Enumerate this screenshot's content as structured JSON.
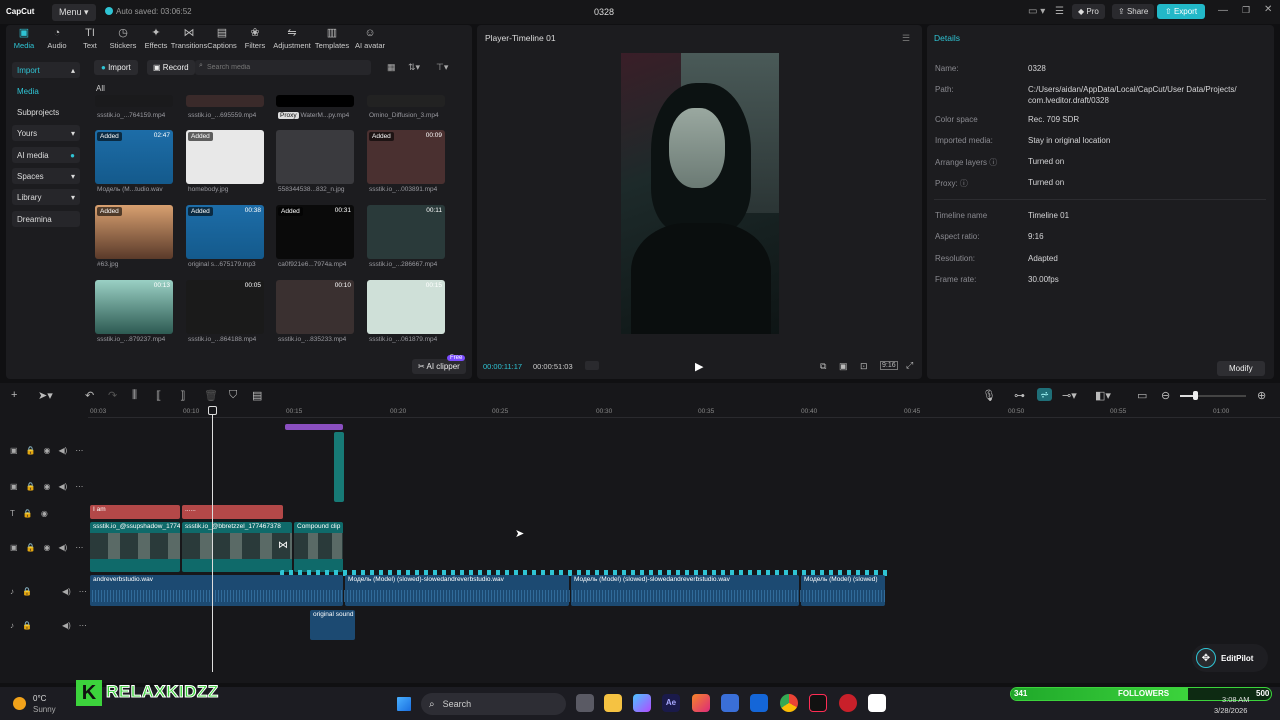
{
  "titlebar": {
    "logo": "CapCut",
    "menu_label": "Menu",
    "autosave": "Auto saved: 03:06:52",
    "project_title": "0328",
    "pro_label": "Pro",
    "share_label": "Share",
    "export_label": "Export"
  },
  "toolbar": {
    "items": [
      "Media",
      "Audio",
      "Text",
      "Stickers",
      "Effects",
      "Transitions",
      "Captions",
      "Filters",
      "Adjustment",
      "Templates",
      "AI avatar"
    ]
  },
  "sidebar": {
    "import": "Import",
    "media": "Media",
    "subprojects": "Subprojects",
    "yours": "Yours",
    "ai_media": "AI media",
    "spaces": "Spaces",
    "library": "Library",
    "dreamina": "Dreamina"
  },
  "media_panel": {
    "import_btn": "Import",
    "record_btn": "Record",
    "search_placeholder": "Search media",
    "all_label": "All",
    "ai_clipper": "AI clipper",
    "free_badge": "Free",
    "row0": [
      "ssstik.io_...764159.mp4",
      "ssstik.io_...695559.mp4",
      "WaterM...py.mp4",
      "Omino_Diffusion_3.mp4"
    ],
    "proxy_badge": "Proxy",
    "items": [
      {
        "name": "Модель (M...tudio.wav",
        "badge": "Added",
        "dur": "02:47"
      },
      {
        "name": "homebody.jpg",
        "badge": "Added",
        "dur": ""
      },
      {
        "name": "558344538...832_n.jpg",
        "badge": "",
        "dur": ""
      },
      {
        "name": "ssstik.io_...003891.mp4",
        "badge": "Added",
        "dur": "00:09"
      },
      {
        "name": "#63.jpg",
        "badge": "Added",
        "dur": ""
      },
      {
        "name": "original s...675179.mp3",
        "badge": "Added",
        "dur": "00:38"
      },
      {
        "name": "ca0f921e6...7974a.mp4",
        "badge": "Added",
        "dur": "00:31"
      },
      {
        "name": "ssstik.io_...286667.mp4",
        "badge": "",
        "dur": "00:11"
      },
      {
        "name": "ssstik.io_...879237.mp4",
        "badge": "",
        "dur": "00:13"
      },
      {
        "name": "ssstik.io_...864188.mp4",
        "badge": "",
        "dur": "00:05"
      },
      {
        "name": "ssstik.io_...835233.mp4",
        "badge": "",
        "dur": "00:10"
      },
      {
        "name": "ssstik.io_...061879.mp4",
        "badge": "",
        "dur": "00:15"
      }
    ]
  },
  "player": {
    "title": "Player-Timeline 01",
    "current_time": "00:00:11:17",
    "total_time": "00:00:51:03",
    "ratio": "9:16"
  },
  "details": {
    "title": "Details",
    "rows": [
      {
        "k": "Name:",
        "v": "0328"
      },
      {
        "k": "Path:",
        "v": "C:/Users/aidan/AppData/Local/CapCut/User Data/Projects/ com.lveditor.draft/0328"
      },
      {
        "k": "Color space",
        "v": "Rec. 709 SDR"
      },
      {
        "k": "Imported media:",
        "v": "Stay in original location"
      },
      {
        "k": "Arrange layers",
        "v": "Turned on"
      },
      {
        "k": "Proxy:",
        "v": "Turned on"
      },
      {
        "k": "Timeline name",
        "v": "Timeline 01"
      },
      {
        "k": "Aspect ratio:",
        "v": "9:16"
      },
      {
        "k": "Resolution:",
        "v": "Adapted"
      },
      {
        "k": "Frame rate:",
        "v": "30.00fps"
      }
    ],
    "modify_btn": "Modify"
  },
  "timeline": {
    "ruler": [
      "00:03",
      "00:10",
      "00:15",
      "00:20",
      "00:25",
      "00:30",
      "00:35",
      "00:40",
      "00:45",
      "00:50",
      "00:55",
      "01:00"
    ],
    "text_clip1": "I am",
    "text_clip2": "......",
    "video_clip1": "ssstik.io_@ssupshadow_177467",
    "video_clip2": "ssstik.io_@bbretzzel_177467378",
    "compound": "Compound clip",
    "audio1": "andreverbstudio.wav",
    "audio2": "Модель (Model) (slowed)-slowedandreverbstudio.wav",
    "audio3": "Модель (Model) (slowed)-slowedandreverbstudio.wav",
    "audio4": "Модель (Model) (slowed)",
    "orig_sound": "original sound"
  },
  "overlay": {
    "editpilot": "EditPilot",
    "brand": "RELAXKIDZZ",
    "followers_count": "341",
    "followers_label": "FOLLOWERS",
    "followers_goal": "500"
  },
  "taskbar": {
    "temp": "0°C",
    "weather": "Sunny",
    "search": "Search",
    "time": "3:08 AM",
    "date": "3/28/2026"
  },
  "colors": {
    "accent": "#2fc4d4",
    "text_clip": "#b34848",
    "audio": "#1c4a72",
    "video": "#0f6a6a"
  }
}
